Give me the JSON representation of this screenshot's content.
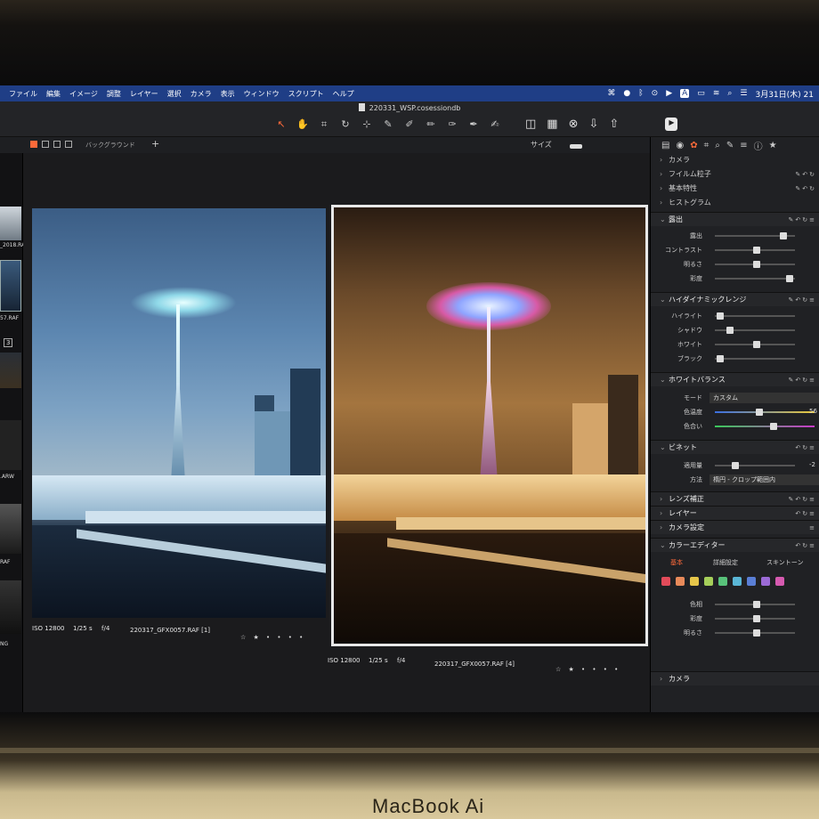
{
  "brand": "MacBook Ai",
  "menubar": {
    "items": [
      "ファイル",
      "編集",
      "イメージ",
      "調整",
      "レイヤー",
      "選択",
      "カメラ",
      "表示",
      "ウィンドウ",
      "スクリプト",
      "ヘルプ"
    ],
    "clock": "3月31日(木) 21",
    "status_icons": [
      "keyboard-icon",
      "line-icon",
      "bluetooth-icon",
      "dot-icon",
      "play-icon",
      "text-input-icon",
      "battery-icon",
      "wifi-icon",
      "search-icon",
      "control-center-icon"
    ],
    "input_mode": "A"
  },
  "window": {
    "title": "220331_WSP.cosessiondb"
  },
  "toolbar": {
    "tools": [
      "cursor-icon",
      "hand-icon",
      "crop-icon",
      "straighten-icon",
      "rotate-icon",
      "keystone-icon",
      "brush-icon",
      "eraser-icon",
      "mask-brush-icon",
      "gradient-icon",
      "clone-icon",
      "heal-icon"
    ],
    "right_icons": [
      "compare-icon",
      "grid-view-icon",
      "exclude-icon",
      "import-icon",
      "export-icon",
      "learn-icon"
    ]
  },
  "subtoolbar": {
    "background_label": "バックグラウンド",
    "add_label": "+",
    "size_label": "サイズ"
  },
  "filmstrip": {
    "labels": [
      "_2018.RAF",
      "57.RAF",
      ".ARW",
      "RAF",
      "NG"
    ],
    "badge": "3"
  },
  "photos": [
    {
      "iso": "ISO 12800",
      "shutter": "1/25 s",
      "aperture": "f/4",
      "filename": "220317_GFX0057.RAF [1]",
      "rating": "☆ ★ • • • •"
    },
    {
      "iso": "ISO 12800",
      "shutter": "1/25 s",
      "aperture": "f/4",
      "filename": "220317_GFX0057.RAF [4]",
      "rating": "☆ ★ • • • •"
    }
  ],
  "panel": {
    "tab_icons": [
      "folder-icon",
      "camera-icon",
      "color-icon",
      "crop-icon",
      "search-icon",
      "pen-icon",
      "sliders-icon",
      "info-icon",
      "star-icon"
    ],
    "collapsed_top": [
      "カメラ",
      "フイルム粒子",
      "基本特性",
      "ヒストグラム"
    ],
    "exposure": {
      "title": "露出",
      "rows": [
        {
          "label": "露出",
          "pos": 0.85
        },
        {
          "label": "コントラスト",
          "pos": 0.5
        },
        {
          "label": "明るさ",
          "pos": 0.5
        },
        {
          "label": "彩度",
          "pos": 0.93
        }
      ]
    },
    "hdr": {
      "title": "ハイダイナミックレンジ",
      "rows": [
        {
          "label": "ハイライト",
          "pos": 0.02
        },
        {
          "label": "シャドウ",
          "pos": 0.15
        },
        {
          "label": "ホワイト",
          "pos": 0.5
        },
        {
          "label": "ブラック",
          "pos": 0.02
        }
      ]
    },
    "white_balance": {
      "title": "ホワイトバランス",
      "mode_label": "モード",
      "mode_value": "カスタム",
      "temp_label": "色温度",
      "temp_value": "56",
      "temp_pos": 0.53,
      "tint_label": "色合い",
      "tint_pos": 0.72
    },
    "vignette": {
      "title": "ビネット",
      "amount_label": "適用量",
      "amount_value": "-2",
      "amount_pos": 0.22,
      "method_label": "方法",
      "method_value": "楕円 - クロップ範囲内"
    },
    "collapsed_mid": [
      "レンズ補正",
      "レイヤー",
      "カメラ設定"
    ],
    "color_editor": {
      "title": "カラーエディター",
      "tabs": [
        "基本",
        "詳細設定",
        "スキントーン"
      ],
      "swatches": [
        "#e24b5a",
        "#e88a5a",
        "#e6c64a",
        "#a6cf5a",
        "#58c27a",
        "#5ab6d6",
        "#5a7fd6",
        "#9b6ad6",
        "#d65ab0"
      ],
      "rows": [
        {
          "label": "色相",
          "pos": 0.5
        },
        {
          "label": "彩度",
          "pos": 0.5
        },
        {
          "label": "明るさ",
          "pos": 0.5
        }
      ]
    },
    "bottom": "カメラ"
  },
  "colors": {
    "menubar": "#1f3e86",
    "accent": "#ff6a3a"
  }
}
